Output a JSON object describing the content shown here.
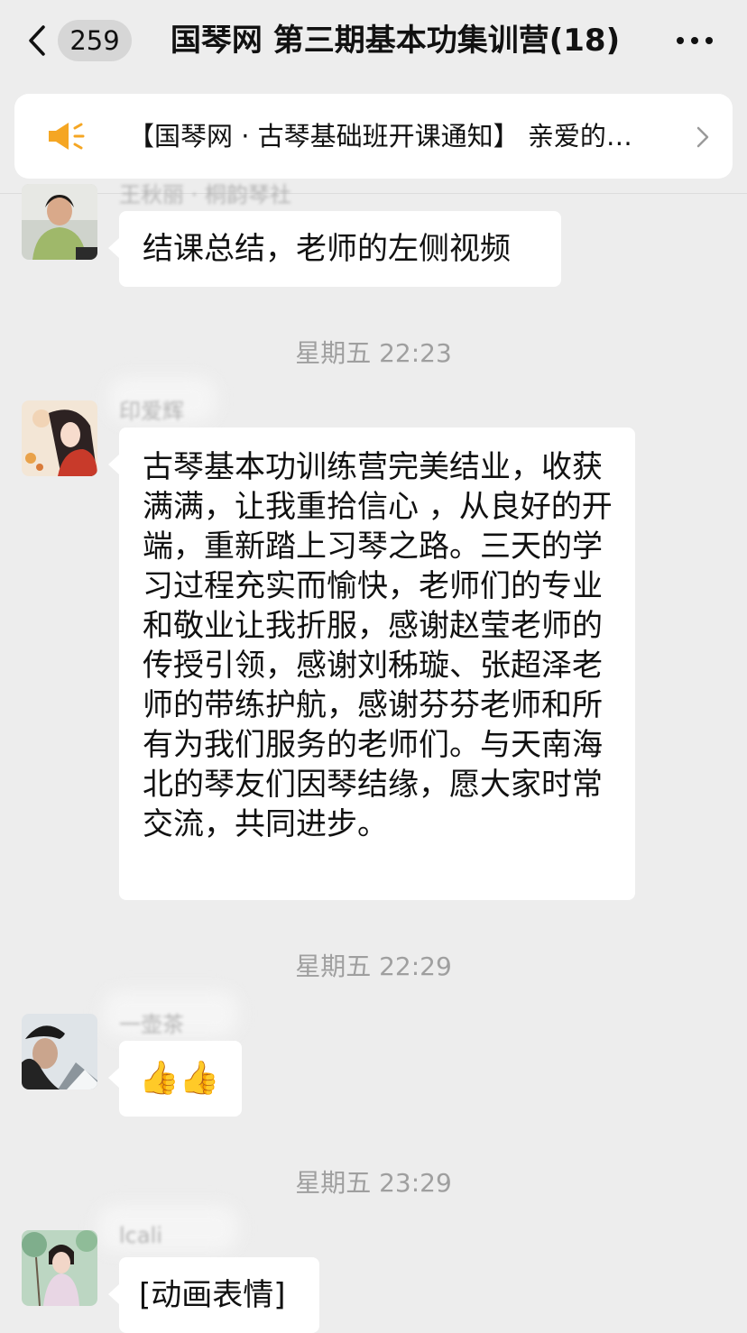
{
  "header": {
    "unread_count": "259",
    "title": "国琴网 第三期基本功集训营(18)"
  },
  "notice": {
    "text": "【国琴网 · 古琴基础班开课通知】 亲爱的…"
  },
  "messages": [
    {
      "sender": "王秋丽 · 桐韵琴社",
      "text": "结课总结，老师的左侧视频"
    },
    {
      "time": "星期五 22:23"
    },
    {
      "sender": "印爱辉",
      "text": "古琴基本功训练营完美结业，收获满满，让我重拾信心 ，从良好的开端，重新踏上习琴之路。三天的学习过程充实而愉快，老师们的专业和敬业让我折服，感谢赵莹老师的传授引领，感谢刘秭璇、张超泽老师的带练护航，感谢芬芬老师和所有为我们服务的老师们。与天南海北的琴友们因琴结缘，愿大家时常交流，共同进步。"
    },
    {
      "time": "星期五 22:29"
    },
    {
      "sender": "一壶茶",
      "text": "👍👍"
    },
    {
      "time": "星期五 23:29"
    },
    {
      "sender": "lcali",
      "text": "[动画表情]"
    }
  ],
  "colors": {
    "background": "#ededed",
    "bubble": "#ffffff",
    "timestamp": "#9f9f9f",
    "notice_icon": "#f5a623"
  }
}
